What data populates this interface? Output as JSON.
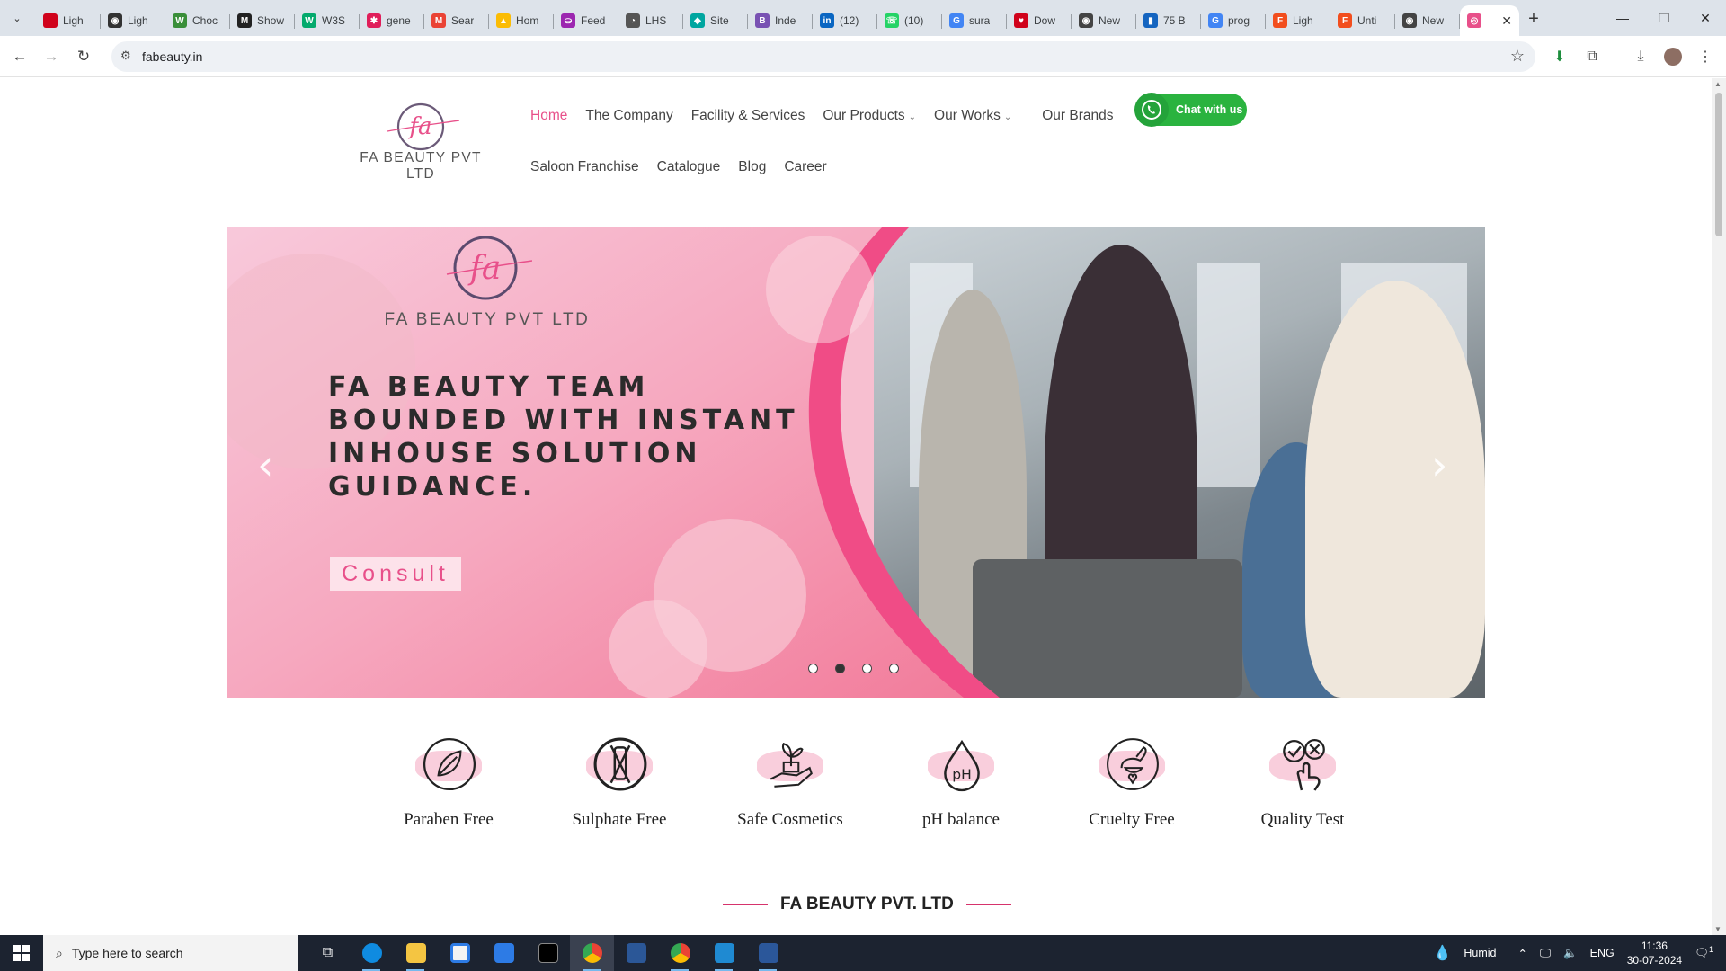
{
  "browser": {
    "tabs": [
      {
        "title": "Ligh",
        "color": "#d0021b",
        "glyph": ""
      },
      {
        "title": "Ligh",
        "color": "#333333",
        "glyph": "◉"
      },
      {
        "title": "Choc",
        "color": "#3a8f3a",
        "glyph": "W"
      },
      {
        "title": "Show",
        "color": "#222222",
        "glyph": "M"
      },
      {
        "title": "W3S",
        "color": "#04aa6d",
        "glyph": "W"
      },
      {
        "title": "gene",
        "color": "#e01e5a",
        "glyph": "✱"
      },
      {
        "title": "Sear",
        "color": "#ea4335",
        "glyph": "M"
      },
      {
        "title": "Hom",
        "color": "#fbbc04",
        "glyph": "▲"
      },
      {
        "title": "Feed",
        "color": "#9c27b0",
        "glyph": "⛀"
      },
      {
        "title": "LHS",
        "color": "#555555",
        "glyph": "◔"
      },
      {
        "title": "Site",
        "color": "#00a6a0",
        "glyph": "◆"
      },
      {
        "title": "Inde",
        "color": "#7952b3",
        "glyph": "B"
      },
      {
        "title": "(12)",
        "color": "#0a66c2",
        "glyph": "in"
      },
      {
        "title": "(10)",
        "color": "#25d366",
        "glyph": "☏"
      },
      {
        "title": "sura",
        "color": "#4285f4",
        "glyph": "G"
      },
      {
        "title": "Dow",
        "color": "#d0021b",
        "glyph": "♥"
      },
      {
        "title": "New",
        "color": "#444444",
        "glyph": "◉"
      },
      {
        "title": "75 B",
        "color": "#1565c0",
        "glyph": "▮"
      },
      {
        "title": "prog",
        "color": "#4285f4",
        "glyph": "G"
      },
      {
        "title": "Ligh",
        "color": "#f24e1e",
        "glyph": "F"
      },
      {
        "title": "Unti",
        "color": "#f24e1e",
        "glyph": "F"
      },
      {
        "title": "New",
        "color": "#444444",
        "glyph": "◉"
      },
      {
        "title": "",
        "color": "#e8508a",
        "glyph": "◎",
        "active": true
      }
    ],
    "new_tab": "+",
    "window_controls": {
      "minimize": "—",
      "restore": "❐",
      "close": "✕"
    },
    "url": "fabeauty.in"
  },
  "site": {
    "logo_text": "FA BEAUTY PVT LTD",
    "nav_row1": [
      {
        "label": "Home",
        "active": true
      },
      {
        "label": "The Company"
      },
      {
        "label": "Facility & Services"
      },
      {
        "label": "Our Products",
        "dropdown": true
      },
      {
        "label": "Our Works",
        "dropdown": true
      },
      {
        "label": "Our Brands"
      }
    ],
    "nav_row2": [
      "Saloon Franchise",
      "Catalogue",
      "Blog",
      "Career"
    ],
    "chat_button": "Chat with us",
    "accent_color": "#e8508a",
    "whatsapp_color": "#2ab33f"
  },
  "hero": {
    "logo_text": "FA BEAUTY PVT LTD",
    "headline": [
      "FA BEAUTY TEAM",
      "BOUNDED WITH INSTANT",
      "INHOUSE SOLUTION",
      "GUIDANCE."
    ],
    "cta": "Consult",
    "prev": "‹",
    "next": "›",
    "slides": 4,
    "active_slide": 2
  },
  "features": [
    {
      "label": "Paraben Free",
      "icon": "leaf-icon"
    },
    {
      "label": "Sulphate Free",
      "icon": "no-tube-icon"
    },
    {
      "label": "Safe Cosmetics",
      "icon": "hand-plant-icon"
    },
    {
      "label": "pH balance",
      "icon": "ph-drop-icon"
    },
    {
      "label": "Cruelty Free",
      "icon": "rabbit-heart-icon"
    },
    {
      "label": "Quality Test",
      "icon": "check-hand-icon"
    }
  ],
  "section_title": "FA BEAUTY PVT. LTD",
  "taskbar": {
    "search_placeholder": "Type here to search",
    "weather": "Humid",
    "language": "ENG",
    "time": "11:36",
    "date": "30-07-2024",
    "notifications": "1"
  }
}
